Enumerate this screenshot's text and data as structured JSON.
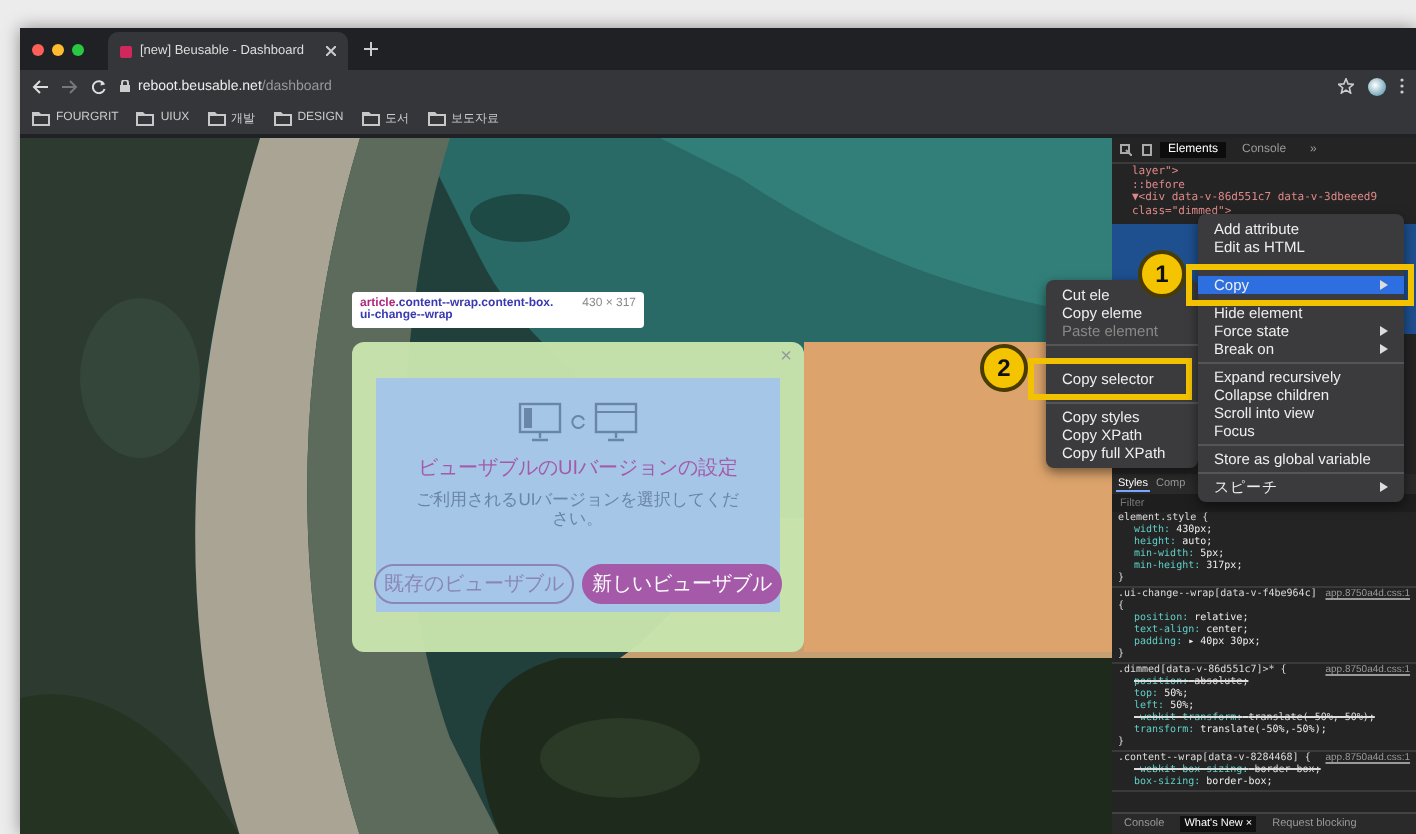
{
  "browser": {
    "tab_title": "[new] Beusable - Dashboard",
    "url_host": "reboot.beusable.net",
    "url_path": "/dashboard",
    "bookmarks": [
      "FOURGRIT",
      "UIUX",
      "개발",
      "DESIGN",
      "도서",
      "보도자료"
    ]
  },
  "page": {
    "tooltip": {
      "tag": "article",
      "rest": ".content--wrap.content-box.",
      "line2": "ui-change--wrap",
      "size": "430 × 317"
    },
    "modal": {
      "close": "×",
      "title": "ビューザブルのUIバージョンの設定",
      "subtitle": "ご利用されるUIバージョンを選択してください。",
      "buttons": [
        {
          "label": "既存のビューザブル",
          "primary": false
        },
        {
          "label": "新しいビューザブル",
          "primary": true
        }
      ]
    }
  },
  "devtools": {
    "tabs": [
      {
        "label": "Elements",
        "selected": true
      },
      {
        "label": "Console",
        "selected": false
      }
    ],
    "more": "»",
    "dom_lines": [
      "layer\">",
      "::before",
      "▼<div data-v-86d551c7 data-v-3dbeeed9",
      "class=\"dimmed\">"
    ],
    "styles_tabs": [
      {
        "label": "Styles",
        "selected": true
      },
      {
        "label": "Comp",
        "selected": false
      }
    ],
    "filter_placeholder": "Filter",
    "rules": [
      {
        "selector": "element.style {",
        "close": "}",
        "declarations": [
          {
            "property": "width:",
            "value": "430px;",
            "struck": false
          },
          {
            "property": "height:",
            "value": "auto;",
            "struck": false
          },
          {
            "property": "min-width:",
            "value": "5px;",
            "struck": false
          },
          {
            "property": "min-height:",
            "value": "317px;",
            "struck": false
          }
        ]
      },
      {
        "selector": ".ui-change--wrap[data-v-f4be964c] {",
        "source": "app.8750a4d.css:1",
        "close": "}",
        "declarations": [
          {
            "property": "position:",
            "value": "relative;",
            "struck": false
          },
          {
            "property": "text-align:",
            "value": "center;",
            "struck": false
          },
          {
            "property": "padding:",
            "value": "▸ 40px 30px;",
            "struck": false
          }
        ]
      },
      {
        "selector": ".dimmed[data-v-86d551c7]>* {",
        "source": "app.8750a4d.css:1",
        "close": "}",
        "declarations": [
          {
            "property": "position:",
            "value": "absolute;",
            "struck": true
          },
          {
            "property": "top:",
            "value": "50%;",
            "struck": false
          },
          {
            "property": "left:",
            "value": "50%;",
            "struck": false
          },
          {
            "property": "-webkit-transform:",
            "value": "translate(-50%,-50%);",
            "struck": true
          },
          {
            "property": "transform:",
            "value": "translate(-50%,-50%);",
            "struck": false
          }
        ]
      },
      {
        "selector": ".content--wrap[data-v-8284468] {",
        "source": "app.8750a4d.css:1",
        "declarations": [
          {
            "property": "-webkit-box-sizing:",
            "value": "border-box;",
            "struck": true
          },
          {
            "property": "box-sizing:",
            "value": "border-box;",
            "struck": false
          }
        ]
      }
    ],
    "drawer_tabs": [
      {
        "label": "Console",
        "selected": false
      },
      {
        "label": "What's New",
        "selected": true,
        "close": "×"
      },
      {
        "label": "Request blocking",
        "selected": false
      }
    ]
  },
  "context_menu": {
    "items": [
      {
        "kind": "item",
        "label": "Add attribute",
        "selected": false,
        "submenu": false
      },
      {
        "kind": "item",
        "label": "Edit as HTML",
        "selected": false,
        "submenu": false
      },
      {
        "kind": "item",
        "label": "Copy",
        "selected": true,
        "submenu": true,
        "callout": "1"
      },
      {
        "kind": "item",
        "label": "Hide element",
        "selected": false,
        "submenu": false
      },
      {
        "kind": "item",
        "label": "Force state",
        "selected": false,
        "submenu": true
      },
      {
        "kind": "item",
        "label": "Break on",
        "selected": false,
        "submenu": true
      },
      {
        "kind": "separator"
      },
      {
        "kind": "item",
        "label": "Expand recursively",
        "selected": false,
        "submenu": false
      },
      {
        "kind": "item",
        "label": "Collapse children",
        "selected": false,
        "submenu": false
      },
      {
        "kind": "item",
        "label": "Scroll into view",
        "selected": false,
        "submenu": false
      },
      {
        "kind": "item",
        "label": "Focus",
        "selected": false,
        "submenu": false
      },
      {
        "kind": "separator"
      },
      {
        "kind": "item",
        "label": "Store as global variable",
        "selected": false,
        "submenu": false
      },
      {
        "kind": "separator"
      },
      {
        "kind": "item",
        "label": "スピーチ",
        "selected": false,
        "submenu": true
      }
    ]
  },
  "copy_submenu": {
    "items": [
      {
        "kind": "item",
        "label": "Cut ele",
        "disabled": false
      },
      {
        "kind": "item",
        "label": "Copy eleme",
        "disabled": false
      },
      {
        "kind": "item",
        "label": "Paste element",
        "disabled": true
      },
      {
        "kind": "separator"
      },
      {
        "kind": "item",
        "label": "Copy selector",
        "disabled": false,
        "callout": "2"
      },
      {
        "kind": "separator"
      },
      {
        "kind": "item",
        "label": "Copy styles",
        "disabled": false
      },
      {
        "kind": "item",
        "label": "Copy XPath",
        "disabled": false
      },
      {
        "kind": "item",
        "label": "Copy full XPath",
        "disabled": false
      }
    ]
  }
}
